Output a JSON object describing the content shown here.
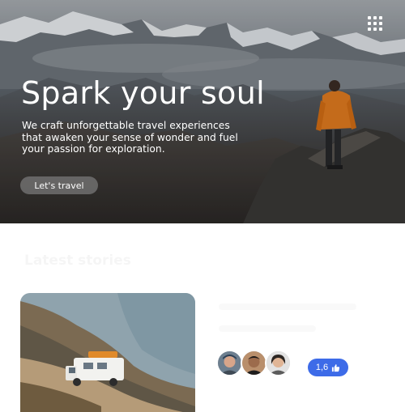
{
  "hero": {
    "title": "Spark your soul",
    "subtitle": "We craft unforgettable travel experiences that awaken your sense of wonder and fuel your passion for exploration.",
    "cta_label": "Let's travel",
    "menu_icon": "grid-menu-icon"
  },
  "section": {
    "title": "Latest stories"
  },
  "card": {
    "image": "camper-van-coastline-photo"
  },
  "social": {
    "avatars": [
      "traveler-avatar-1",
      "traveler-avatar-2",
      "traveler-avatar-3"
    ],
    "likes": "1,6",
    "like_icon": "thumbs-up-icon"
  },
  "colors": {
    "accent": "#3d6be8",
    "cta_bg": "#7a7a7a",
    "jacket": "#e07a1f"
  }
}
